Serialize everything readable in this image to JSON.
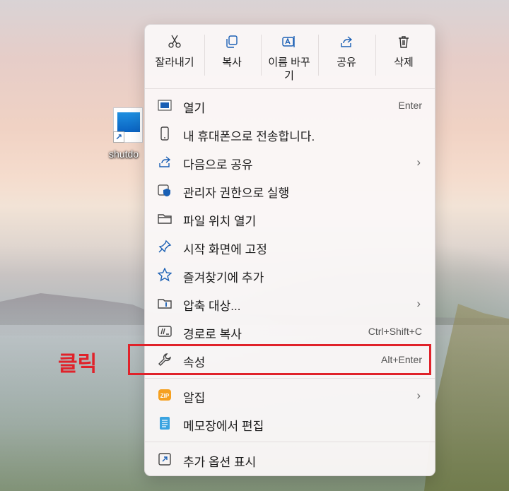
{
  "desktop": {
    "file_label": "shutdo"
  },
  "toolbar": {
    "cut": "잘라내기",
    "copy": "복사",
    "rename": "이름 바꾸기",
    "share": "공유",
    "delete": "삭제"
  },
  "menu": {
    "open": {
      "label": "열기",
      "shortcut": "Enter"
    },
    "send_phone": {
      "label": "내 휴대폰으로 전송합니다."
    },
    "share_with": {
      "label": "다음으로 공유",
      "chevron": "›"
    },
    "run_admin": {
      "label": "관리자 권한으로 실행"
    },
    "open_location": {
      "label": "파일 위치 열기"
    },
    "pin_start": {
      "label": "시작 화면에 고정"
    },
    "add_favorites": {
      "label": "즐겨찾기에 추가"
    },
    "compress": {
      "label": "압축 대상...",
      "chevron": "›"
    },
    "copy_path": {
      "label": "경로로 복사",
      "shortcut": "Ctrl+Shift+C"
    },
    "properties": {
      "label": "속성",
      "shortcut": "Alt+Enter"
    },
    "alzip": {
      "label": "알집",
      "chevron": "›",
      "badge": "ZIP"
    },
    "edit_notepad": {
      "label": "메모장에서 편집"
    },
    "more_options": {
      "label": "추가 옵션 표시"
    }
  },
  "annotation": {
    "click_label": "클릭",
    "color": "#e0222a"
  },
  "colors": {
    "accent_blue": "#1a5fb4",
    "alzip_orange": "#f5a020"
  }
}
